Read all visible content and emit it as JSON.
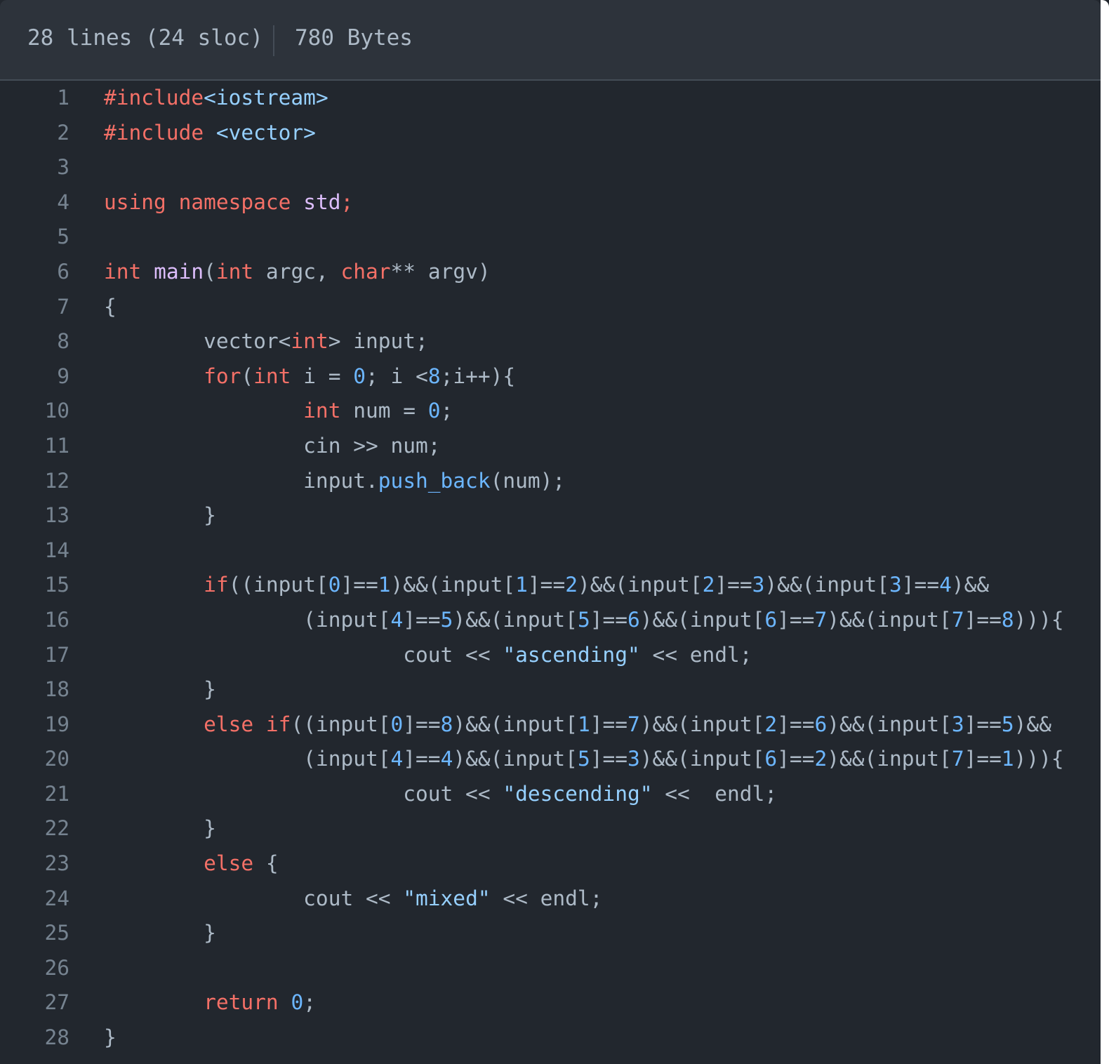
{
  "file_header": {
    "lines_info": "28 lines (24 sloc)",
    "size_info": "780 Bytes"
  },
  "colors": {
    "background": "#22272e",
    "header_bg": "#2d333b",
    "plain": "#adbac7",
    "keyword": "#f47067",
    "string": "#96d0ff",
    "number": "#6cb6ff",
    "function": "#dcbdfb",
    "line_number": "#768390"
  },
  "code_lines": [
    {
      "n": "1",
      "tokens": [
        [
          "kw",
          "#include"
        ],
        [
          "str",
          "<iostream>"
        ]
      ]
    },
    {
      "n": "2",
      "tokens": [
        [
          "kw",
          "#include"
        ],
        [
          "pl",
          " "
        ],
        [
          "str",
          "<vector>"
        ]
      ]
    },
    {
      "n": "3",
      "tokens": []
    },
    {
      "n": "4",
      "tokens": [
        [
          "kw",
          "using"
        ],
        [
          "pl",
          " "
        ],
        [
          "kw",
          "namespace"
        ],
        [
          "pl",
          " "
        ],
        [
          "fn",
          "std"
        ],
        [
          "kw",
          ";"
        ]
      ]
    },
    {
      "n": "5",
      "tokens": []
    },
    {
      "n": "6",
      "tokens": [
        [
          "kw",
          "int"
        ],
        [
          "pl",
          " "
        ],
        [
          "fn",
          "main"
        ],
        [
          "pl",
          "("
        ],
        [
          "kw",
          "int"
        ],
        [
          "pl",
          " argc, "
        ],
        [
          "kw",
          "char"
        ],
        [
          "pl",
          "** argv)"
        ]
      ]
    },
    {
      "n": "7",
      "tokens": [
        [
          "pl",
          "{"
        ]
      ]
    },
    {
      "n": "8",
      "tokens": [
        [
          "pl",
          "        vector<"
        ],
        [
          "kw",
          "int"
        ],
        [
          "pl",
          "> input;"
        ]
      ]
    },
    {
      "n": "9",
      "tokens": [
        [
          "pl",
          "        "
        ],
        [
          "kw",
          "for"
        ],
        [
          "pl",
          "("
        ],
        [
          "kw",
          "int"
        ],
        [
          "pl",
          " i = "
        ],
        [
          "num",
          "0"
        ],
        [
          "pl",
          "; i <"
        ],
        [
          "num",
          "8"
        ],
        [
          "pl",
          ";i++){"
        ]
      ]
    },
    {
      "n": "10",
      "tokens": [
        [
          "pl",
          "                "
        ],
        [
          "kw",
          "int"
        ],
        [
          "pl",
          " num = "
        ],
        [
          "num",
          "0"
        ],
        [
          "pl",
          ";"
        ]
      ]
    },
    {
      "n": "11",
      "tokens": [
        [
          "pl",
          "                cin >> num;"
        ]
      ]
    },
    {
      "n": "12",
      "tokens": [
        [
          "pl",
          "                input."
        ],
        [
          "num",
          "push_back"
        ],
        [
          "pl",
          "(num);"
        ]
      ]
    },
    {
      "n": "13",
      "tokens": [
        [
          "pl",
          "        }"
        ]
      ]
    },
    {
      "n": "14",
      "tokens": []
    },
    {
      "n": "15",
      "tokens": [
        [
          "pl",
          "        "
        ],
        [
          "kw",
          "if"
        ],
        [
          "pl",
          "((input["
        ],
        [
          "num",
          "0"
        ],
        [
          "pl",
          "]=="
        ],
        [
          "num",
          "1"
        ],
        [
          "pl",
          ")&&(input["
        ],
        [
          "num",
          "1"
        ],
        [
          "pl",
          "]=="
        ],
        [
          "num",
          "2"
        ],
        [
          "pl",
          ")&&(input["
        ],
        [
          "num",
          "2"
        ],
        [
          "pl",
          "]=="
        ],
        [
          "num",
          "3"
        ],
        [
          "pl",
          ")&&(input["
        ],
        [
          "num",
          "3"
        ],
        [
          "pl",
          "]=="
        ],
        [
          "num",
          "4"
        ],
        [
          "pl",
          ")&&"
        ]
      ]
    },
    {
      "n": "16",
      "tokens": [
        [
          "pl",
          "                (input["
        ],
        [
          "num",
          "4"
        ],
        [
          "pl",
          "]=="
        ],
        [
          "num",
          "5"
        ],
        [
          "pl",
          ")&&(input["
        ],
        [
          "num",
          "5"
        ],
        [
          "pl",
          "]=="
        ],
        [
          "num",
          "6"
        ],
        [
          "pl",
          ")&&(input["
        ],
        [
          "num",
          "6"
        ],
        [
          "pl",
          "]=="
        ],
        [
          "num",
          "7"
        ],
        [
          "pl",
          ")&&(input["
        ],
        [
          "num",
          "7"
        ],
        [
          "pl",
          "]=="
        ],
        [
          "num",
          "8"
        ],
        [
          "pl",
          "))){"
        ]
      ]
    },
    {
      "n": "17",
      "tokens": [
        [
          "pl",
          "                        cout << "
        ],
        [
          "str",
          "\"ascending\""
        ],
        [
          "pl",
          " << endl;"
        ]
      ]
    },
    {
      "n": "18",
      "tokens": [
        [
          "pl",
          "        }"
        ]
      ]
    },
    {
      "n": "19",
      "tokens": [
        [
          "pl",
          "        "
        ],
        [
          "kw",
          "else"
        ],
        [
          "pl",
          " "
        ],
        [
          "kw",
          "if"
        ],
        [
          "pl",
          "((input["
        ],
        [
          "num",
          "0"
        ],
        [
          "pl",
          "]=="
        ],
        [
          "num",
          "8"
        ],
        [
          "pl",
          ")&&(input["
        ],
        [
          "num",
          "1"
        ],
        [
          "pl",
          "]=="
        ],
        [
          "num",
          "7"
        ],
        [
          "pl",
          ")&&(input["
        ],
        [
          "num",
          "2"
        ],
        [
          "pl",
          "]=="
        ],
        [
          "num",
          "6"
        ],
        [
          "pl",
          ")&&(input["
        ],
        [
          "num",
          "3"
        ],
        [
          "pl",
          "]=="
        ],
        [
          "num",
          "5"
        ],
        [
          "pl",
          ")&&"
        ]
      ]
    },
    {
      "n": "20",
      "tokens": [
        [
          "pl",
          "                (input["
        ],
        [
          "num",
          "4"
        ],
        [
          "pl",
          "]=="
        ],
        [
          "num",
          "4"
        ],
        [
          "pl",
          ")&&(input["
        ],
        [
          "num",
          "5"
        ],
        [
          "pl",
          "]=="
        ],
        [
          "num",
          "3"
        ],
        [
          "pl",
          ")&&(input["
        ],
        [
          "num",
          "6"
        ],
        [
          "pl",
          "]=="
        ],
        [
          "num",
          "2"
        ],
        [
          "pl",
          ")&&(input["
        ],
        [
          "num",
          "7"
        ],
        [
          "pl",
          "]=="
        ],
        [
          "num",
          "1"
        ],
        [
          "pl",
          "))){"
        ]
      ]
    },
    {
      "n": "21",
      "tokens": [
        [
          "pl",
          "                        cout << "
        ],
        [
          "str",
          "\"descending\""
        ],
        [
          "pl",
          " <<  endl;"
        ]
      ]
    },
    {
      "n": "22",
      "tokens": [
        [
          "pl",
          "        }"
        ]
      ]
    },
    {
      "n": "23",
      "tokens": [
        [
          "pl",
          "        "
        ],
        [
          "kw",
          "else"
        ],
        [
          "pl",
          " {"
        ]
      ]
    },
    {
      "n": "24",
      "tokens": [
        [
          "pl",
          "                cout << "
        ],
        [
          "str",
          "\"mixed\""
        ],
        [
          "pl",
          " << endl;"
        ]
      ]
    },
    {
      "n": "25",
      "tokens": [
        [
          "pl",
          "        }"
        ]
      ]
    },
    {
      "n": "26",
      "tokens": []
    },
    {
      "n": "27",
      "tokens": [
        [
          "pl",
          "        "
        ],
        [
          "kw",
          "return"
        ],
        [
          "pl",
          " "
        ],
        [
          "num",
          "0"
        ],
        [
          "pl",
          ";"
        ]
      ]
    },
    {
      "n": "28",
      "tokens": [
        [
          "pl",
          "}"
        ]
      ]
    }
  ]
}
